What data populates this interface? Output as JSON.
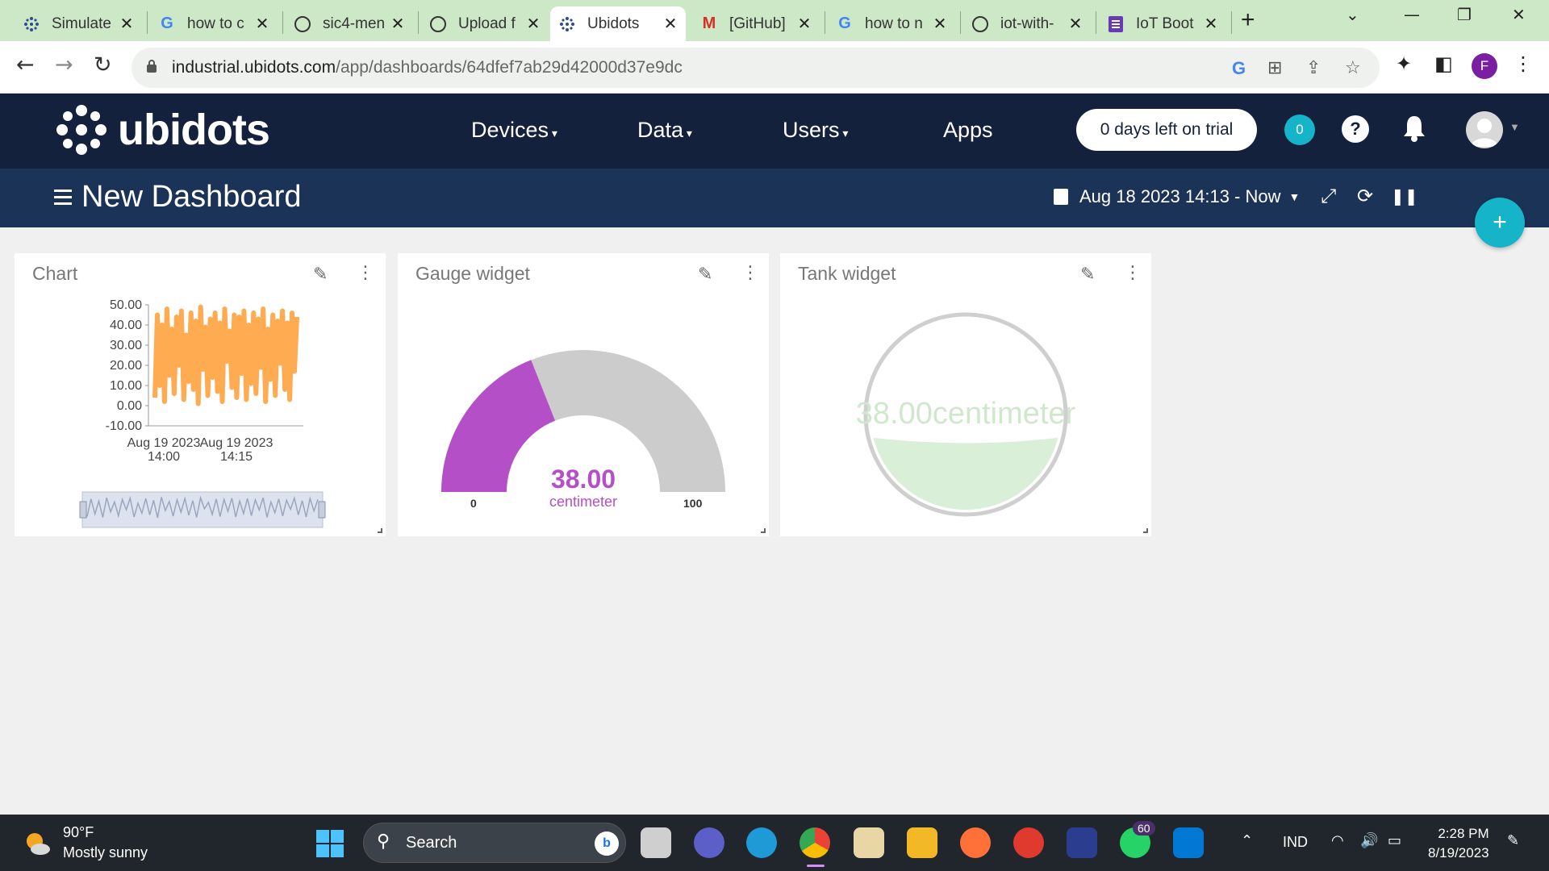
{
  "browser": {
    "tabs": [
      {
        "title": "Simulate",
        "icon": "ubidots-icon"
      },
      {
        "title": "how to c",
        "icon": "google-icon"
      },
      {
        "title": "sic4-men",
        "icon": "github-icon"
      },
      {
        "title": "Upload f",
        "icon": "github-icon"
      },
      {
        "title": "Ubidots",
        "icon": "ubidots-icon",
        "active": true
      },
      {
        "title": "[GitHub]",
        "icon": "gmail-icon"
      },
      {
        "title": "how to n",
        "icon": "google-icon"
      },
      {
        "title": "iot-with-",
        "icon": "github-icon"
      },
      {
        "title": "IoT Boot",
        "icon": "forms-icon"
      }
    ],
    "url_domain": "industrial.ubidots.com",
    "url_path": "/app/dashboards/64dfef7ab29d42000d37e9dc",
    "profile_initial": "F"
  },
  "header": {
    "logo_text": "ubidots",
    "menu": [
      {
        "label": "Devices",
        "dropdown": true
      },
      {
        "label": "Data",
        "dropdown": true
      },
      {
        "label": "Users",
        "dropdown": true
      },
      {
        "label": "Apps",
        "dropdown": false
      }
    ],
    "trial_label": "0 days left on trial",
    "notification_count": "0",
    "help_label": "?"
  },
  "dashboard": {
    "title": "New Dashboard",
    "date_range": "Aug 18 2023 14:13 - Now",
    "add_label": "+"
  },
  "widgets": {
    "chart": {
      "title": "Chart"
    },
    "gauge": {
      "title": "Gauge widget",
      "value": "38.00",
      "unit": "centimeter",
      "min": "0",
      "max": "100",
      "fill_fraction": 0.38
    },
    "tank": {
      "title": "Tank widget",
      "label": "38.00centimeter",
      "fill_fraction": 0.38
    }
  },
  "chart_data": {
    "type": "line",
    "title": "",
    "yticks": [
      "50.00",
      "40.00",
      "30.00",
      "20.00",
      "10.00",
      "0.00",
      "-10.00"
    ],
    "ylim": [
      -10,
      50
    ],
    "xticks": [
      {
        "line1": "Aug 19 2023",
        "line2": "14:00"
      },
      {
        "line1": "Aug 19 2023",
        "line2": "14:15"
      }
    ],
    "series": [
      {
        "values": [
          4,
          45,
          10,
          40,
          2,
          48,
          15,
          38,
          6,
          44,
          20,
          47,
          3,
          35,
          12,
          46,
          8,
          42,
          1,
          49,
          18,
          39,
          5,
          43,
          14,
          46,
          7,
          41,
          2,
          48,
          22,
          37,
          9,
          45,
          4,
          44,
          16,
          47,
          3,
          40,
          11,
          46,
          6,
          43,
          19,
          48,
          2,
          38,
          13,
          45,
          5,
          42,
          21,
          47,
          8,
          41,
          3,
          46,
          17,
          44
        ]
      }
    ],
    "color": "#ffab52",
    "grid": false
  },
  "taskbar": {
    "weather_temp": "90°F",
    "weather_desc": "Mostly sunny",
    "search_label": "Search",
    "whatsapp_badge": "60",
    "language": "IND",
    "time": "2:28 PM",
    "date": "8/19/2023"
  }
}
